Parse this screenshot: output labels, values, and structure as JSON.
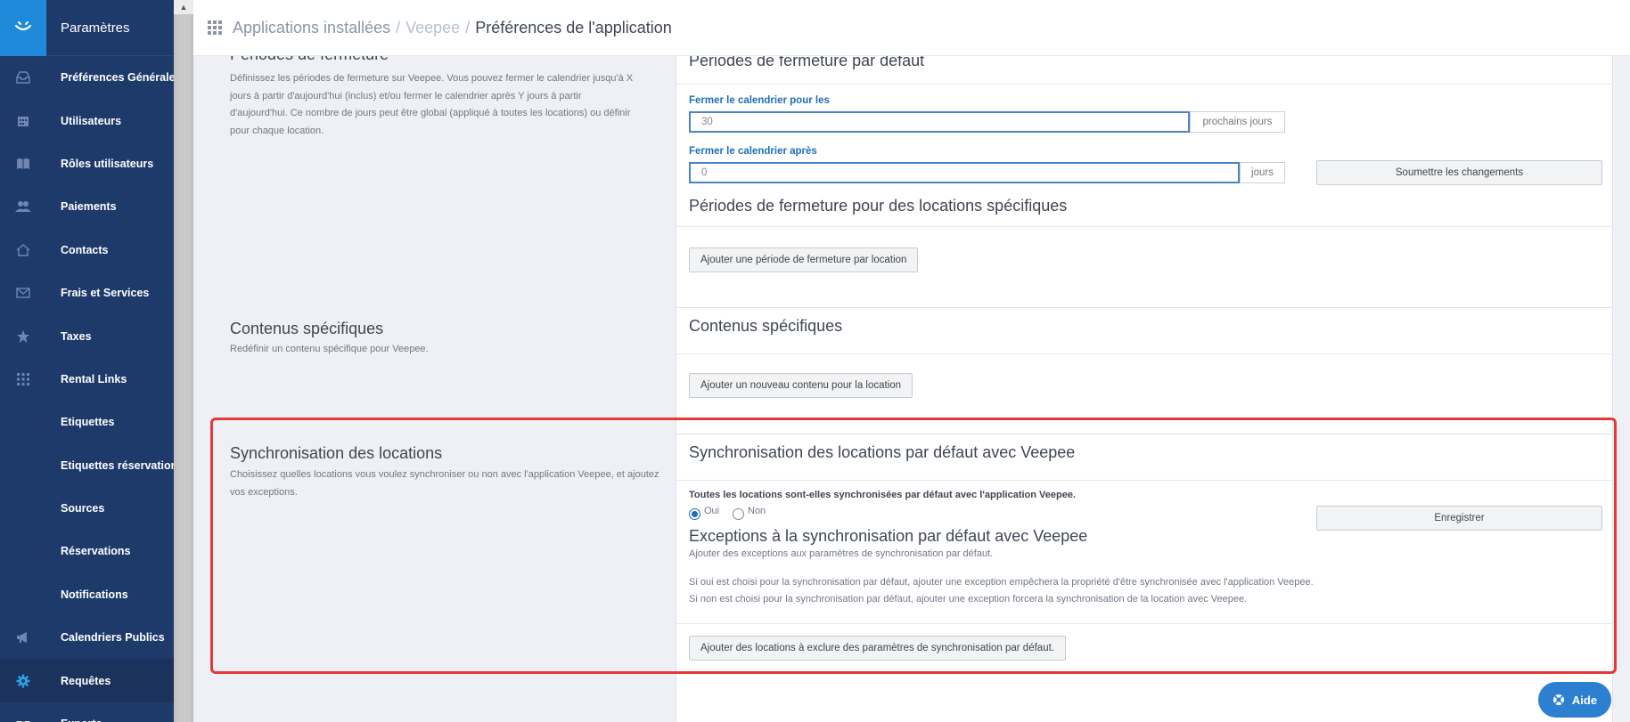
{
  "sidebar": {
    "header": "Paramètres",
    "items": [
      {
        "label": "Préférences Générales",
        "icon": "inbox-icon"
      },
      {
        "label": "Utilisateurs",
        "icon": "calendar-icon"
      },
      {
        "label": "Rôles utilisateurs",
        "icon": "book-icon"
      },
      {
        "label": "Paiements",
        "icon": "users-icon"
      },
      {
        "label": "Contacts",
        "icon": "home-icon"
      },
      {
        "label": "Frais et Services",
        "icon": "mail-icon"
      },
      {
        "label": "Taxes",
        "icon": "star-icon"
      },
      {
        "label": "Rental Links",
        "icon": "grid-icon"
      },
      {
        "label": "Etiquettes",
        "icon": ""
      },
      {
        "label": "Etiquettes réservation",
        "icon": ""
      },
      {
        "label": "Sources",
        "icon": ""
      },
      {
        "label": "Réservations",
        "icon": ""
      },
      {
        "label": "Notifications",
        "icon": ""
      },
      {
        "label": "Calendriers Publics",
        "icon": "megaphone-icon"
      },
      {
        "label": "Requêtes",
        "icon": "gear-icon"
      },
      {
        "label": "Exports",
        "icon": "avatar"
      }
    ]
  },
  "breadcrumb": {
    "part1": "Applications installées",
    "part2": "Veepee",
    "current": "Préférences de l'application",
    "separator": "/"
  },
  "closing": {
    "title": "Périodes de fermeture",
    "description": "Définissez les périodes de fermeture sur Veepee. Vous pouvez fermer le calendrier jusqu'à X jours à partir d'aujourd'hui (inclus) et/ou fermer le calendrier après Y jours à partir d'aujourd'hui. Ce nombre de jours peut être global (appliqué à toutes les locations) ou définir pour chaque location.",
    "panel_title": "Périodes de fermeture par défaut",
    "close_for_label": "Fermer le calendrier pour les",
    "close_for_value": "30",
    "close_for_suffix": "prochains jours",
    "close_after_label": "Fermer le calendrier après",
    "close_after_value": "0",
    "close_after_suffix": "jours",
    "submit_button": "Soumettre les changements",
    "specific_title": "Périodes de fermeture pour des locations spécifiques",
    "add_button": "Ajouter une période de fermeture par location"
  },
  "specific_content": {
    "title": "Contenus spécifiques",
    "description": "Redéfinir un contenu spécifique pour Veepee.",
    "panel_title": "Contenus spécifiques",
    "add_button": "Ajouter un nouveau contenu pour la location"
  },
  "sync": {
    "title": "Synchronisation des locations",
    "description": "Choisissez quelles locations vous voulez synchroniser ou non avec l'application Veepee, et ajoutez vos exceptions.",
    "panel_title": "Synchronisation des locations par défaut avec Veepee",
    "question": "Toutes les locations sont-elles synchronisées par défaut avec l'application Veepee.",
    "yes_label": "Oui",
    "no_label": "Non",
    "selected": "Oui",
    "save_button": "Enregistrer",
    "exceptions_title": "Exceptions à la synchronisation par défaut avec Veepee",
    "exceptions_sub": "Ajouter des exceptions aux paramètres de synchronisation par défaut.",
    "note_yes": "Si oui est choisi pour la synchronisation par défaut, ajouter une exception empêchera la propriété d'être synchronisée avec l'application Veepee.",
    "note_no": "Si non est choisi pour la synchronisation par défaut, ajouter une exception forcera la synchronisation de la location avec Veepee.",
    "add_button": "Ajouter des locations à exclure des paramètres de synchronisation par défaut."
  },
  "help_button": "Aide",
  "colors": {
    "sidebar": "#1e3a6b",
    "accent": "#1f8ad9",
    "highlight": "#e53935",
    "help": "#2d7fd0"
  }
}
